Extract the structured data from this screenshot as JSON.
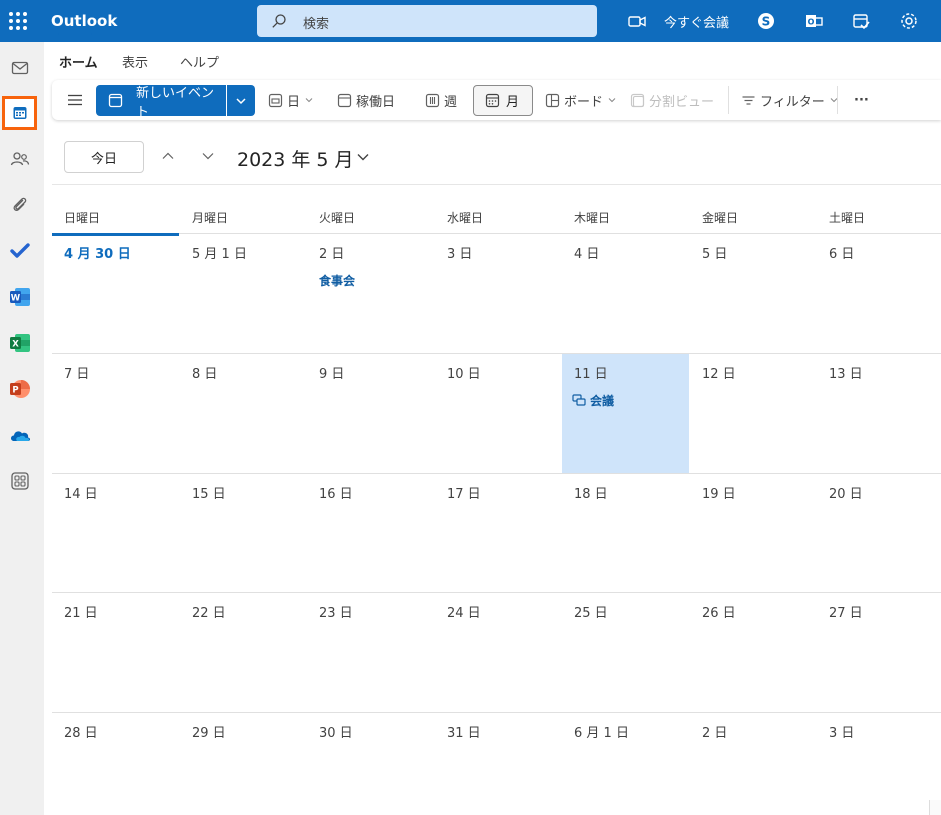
{
  "app": {
    "name": "Outlook"
  },
  "search": {
    "placeholder": "検索"
  },
  "header_actions": {
    "meet_now": "今すぐ会議"
  },
  "ribbon_tabs": [
    "ホーム",
    "表示",
    "ヘルプ"
  ],
  "toolbar": {
    "new_event": "新しいイベント",
    "day": "日",
    "work_week": "稼働日",
    "week": "週",
    "month": "月",
    "board": "ボード",
    "split_view": "分割ビュー",
    "filter": "フィルター",
    "more": "···"
  },
  "calendar": {
    "today_label": "今日",
    "title": "2023 年 5 月",
    "weekdays": [
      "日曜日",
      "月曜日",
      "火曜日",
      "水曜日",
      "木曜日",
      "金曜日",
      "土曜日"
    ],
    "weeks": [
      [
        "4 月 30 日",
        "5 月 1 日",
        "2 日",
        "3 日",
        "4 日",
        "5 日",
        "6 日"
      ],
      [
        "7 日",
        "8 日",
        "9 日",
        "10 日",
        "11 日",
        "12 日",
        "13 日"
      ],
      [
        "14 日",
        "15 日",
        "16 日",
        "17 日",
        "18 日",
        "19 日",
        "20 日"
      ],
      [
        "21 日",
        "22 日",
        "23 日",
        "24 日",
        "25 日",
        "26 日",
        "27 日"
      ],
      [
        "28 日",
        "29 日",
        "30 日",
        "31 日",
        "6 月 1 日",
        "2 日",
        "3 日"
      ]
    ],
    "events": [
      {
        "title": "食事会"
      },
      {
        "title": "会議"
      }
    ]
  },
  "colors": {
    "brand": "#0f6cbd",
    "selected_cell": "#cfe4fa",
    "rail_highlight": "#f7630c"
  },
  "rail_icons": [
    "mail-icon",
    "calendar-icon",
    "people-icon",
    "attachment-icon",
    "todo-icon",
    "word-icon",
    "excel-icon",
    "powerpoint-icon",
    "onedrive-icon",
    "apps-icon"
  ]
}
